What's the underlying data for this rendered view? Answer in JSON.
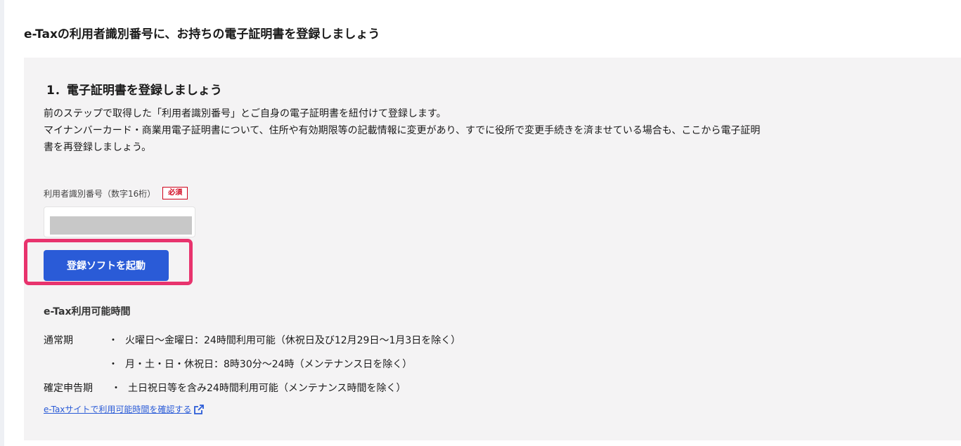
{
  "page": {
    "heading": "e-Taxの利用者識別番号に、お持ちの電子証明書を登録しましょう"
  },
  "step": {
    "title": "1．電子証明書を登録しましょう",
    "description": [
      "前のステップで取得した「利用者識別番号」とご自身の電子証明書を紐付けて登録します。",
      "マイナンバーカード・商業用電子証明書について、住所や有効期限等の記載情報に変更があり、すでに役所で変更手続きを済ませている場合も、ここから電子証明",
      "書を再登録しましょう。"
    ]
  },
  "form": {
    "id_label": "利用者識別番号（数字16桁）",
    "required_badge": "必須",
    "id_value": ""
  },
  "actions": {
    "launch_label": "登録ソフトを起動"
  },
  "hours": {
    "title": "e-Tax利用可能時間",
    "rows": [
      {
        "period": "通常期",
        "text": "火曜日～金曜日：24時間利用可能（休祝日及び12月29日～1月3日を除く）"
      },
      {
        "period": "",
        "text": "月・土・日・休祝日：8時30分～24時（メンテナンス日を除く）"
      },
      {
        "period": "確定申告期",
        "text": "土日祝日等を含み24時間利用可能（メンテナンス時間を除く）"
      }
    ],
    "bullet": "・",
    "link_label": "e-Taxサイトで利用可能時間を確認する",
    "link_icon": "external-link-icon"
  },
  "colors": {
    "button": "#2a5bd7",
    "highlight": "#e8336d",
    "required": "#d0021b",
    "panel": "#f4f3f4"
  }
}
